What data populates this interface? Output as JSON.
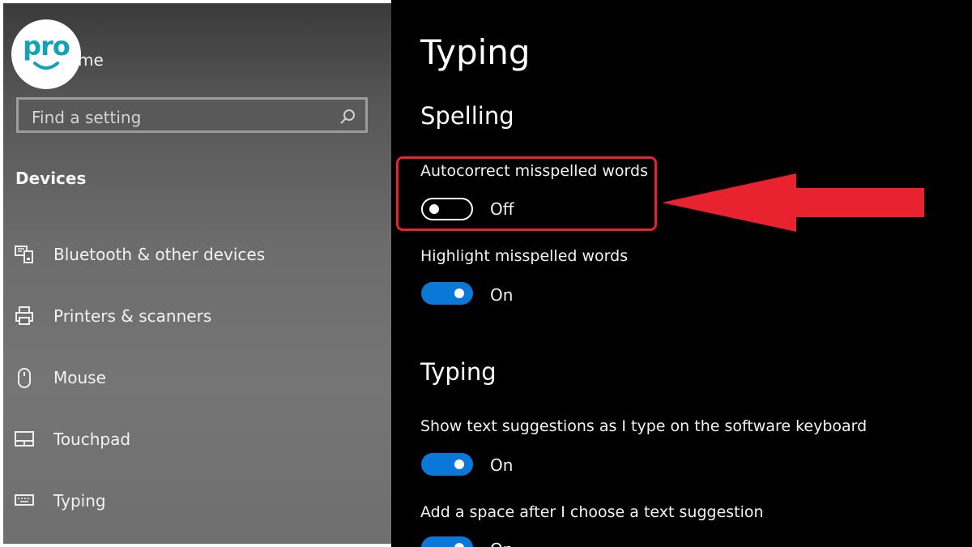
{
  "brand": {
    "logo_text": "pro"
  },
  "sidebar": {
    "home_label": "me",
    "search": {
      "placeholder": "Find a setting"
    },
    "section_title": "Devices",
    "items": [
      {
        "label": "Bluetooth & other devices",
        "icon": "bluetooth-devices-icon"
      },
      {
        "label": "Printers & scanners",
        "icon": "printer-icon"
      },
      {
        "label": "Mouse",
        "icon": "mouse-icon"
      },
      {
        "label": "Touchpad",
        "icon": "touchpad-icon"
      },
      {
        "label": "Typing",
        "icon": "keyboard-icon"
      }
    ]
  },
  "main": {
    "title": "Typing",
    "spelling": {
      "heading": "Spelling",
      "settings": [
        {
          "label": "Autocorrect misspelled words",
          "state": "Off",
          "on": false
        },
        {
          "label": "Highlight misspelled words",
          "state": "On",
          "on": true
        }
      ]
    },
    "typing": {
      "heading": "Typing",
      "settings": [
        {
          "label": "Show text suggestions as I type on the software keyboard",
          "state": "On",
          "on": true
        },
        {
          "label": "Add a space after I choose a text suggestion",
          "state": "On",
          "on": true
        }
      ]
    }
  },
  "colors": {
    "toggle_on": "#0a78d7",
    "annotation_red": "#e8222e",
    "brand_teal": "#14a3b5"
  }
}
